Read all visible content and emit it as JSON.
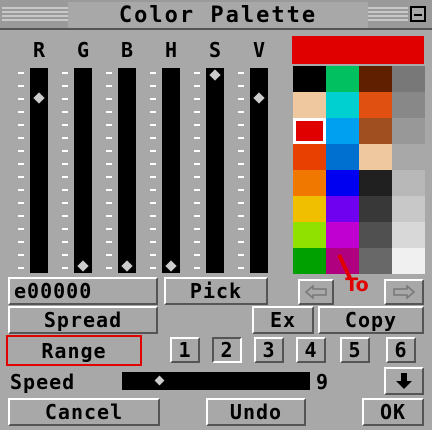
{
  "window": {
    "title": "Color Palette"
  },
  "sliders": [
    {
      "label": "R",
      "level": 0.88
    },
    {
      "label": "G",
      "level": 0.0
    },
    {
      "label": "B",
      "level": 0.0
    },
    {
      "label": "H",
      "level": 0.0
    },
    {
      "label": "S",
      "level": 1.0
    },
    {
      "label": "V",
      "level": 0.88
    }
  ],
  "current_color": "#e00000",
  "palette": [
    [
      "#000000",
      "#00c060",
      "#602000",
      "#787878"
    ],
    [
      "#f0c8a0",
      "#00d0d0",
      "#e05010",
      "#888888"
    ],
    [
      "#e00000",
      "#00a0f0",
      "#a05020",
      "#989898"
    ],
    [
      "#e84000",
      "#0070d0",
      "#f0c8a0",
      "#a8a8a8"
    ],
    [
      "#f07800",
      "#0000f0",
      "#202020",
      "#b8b8b8"
    ],
    [
      "#f0c000",
      "#7000f0",
      "#383838",
      "#c8c8c8"
    ],
    [
      "#90e000",
      "#c000d0",
      "#505050",
      "#d8d8d8"
    ],
    [
      "#00a000",
      "#b00080",
      "#686868",
      "#f0f0f0"
    ]
  ],
  "hex_value": "e00000",
  "buttons": {
    "pick": "Pick",
    "spread": "Spread",
    "ex": "Ex",
    "copy": "Copy",
    "range": "Range",
    "cancel": "Cancel",
    "undo": "Undo",
    "ok": "OK"
  },
  "range_numbers": [
    "1",
    "2",
    "3",
    "4",
    "5",
    "6"
  ],
  "range_selected": "2",
  "speed": {
    "label": "Speed",
    "value": "9",
    "level": 0.06
  },
  "to_label": "To",
  "icons": {
    "close": "minimize-box-icon",
    "arrow_left": "left-arrow-icon",
    "arrow_right": "right-arrow-icon",
    "speed_down": "down-arrow-icon"
  }
}
